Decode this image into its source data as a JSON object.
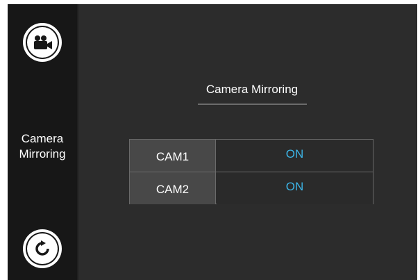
{
  "sidebar": {
    "top_icon": "video-camera-icon",
    "bottom_icon": "refresh-icon",
    "label_line1": "Camera",
    "label_line2": "Mirroring"
  },
  "main": {
    "title": "Camera Mirroring",
    "rows": [
      {
        "label": "CAM1",
        "value": "ON"
      },
      {
        "label": "CAM2",
        "value": "ON"
      }
    ]
  },
  "colors": {
    "accent": "#3cb4e6",
    "background": "#2c2c2c",
    "sidebar": "#171717"
  }
}
